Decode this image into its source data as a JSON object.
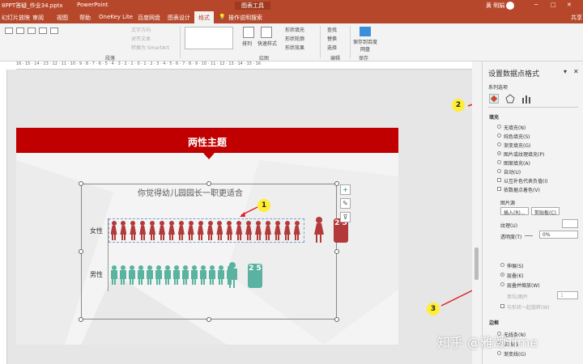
{
  "titlebar": {
    "filename": "8PPT答疑_作业34.pptx",
    "app": "PowerPoint",
    "contextual": "图表工具",
    "user": "黄 明娟"
  },
  "tabs": [
    "幻灯片放映",
    "审阅",
    "视图",
    "帮助",
    "OneKey Lite",
    "百度网盘",
    "图表设计",
    "格式"
  ],
  "active_tab": "格式",
  "tell_me": "操作说明搜索",
  "ribbon": {
    "paragraph": {
      "items": [
        "文字方向",
        "对齐文本",
        "转换为 SmartArt"
      ],
      "label": "段落"
    },
    "drawing": {
      "arrange": "排列",
      "quick_styles": "快速样式",
      "fill": "形状填充",
      "outline": "形状轮廓",
      "effects": "形状效果",
      "label": "绘图"
    },
    "editing": {
      "find": "查找",
      "replace": "替换",
      "select": "选择",
      "label": "编辑"
    },
    "save": {
      "label": "保存到百度网盘",
      "group": "保存"
    }
  },
  "ruler": "16 · 15 · 14 · 13 · 12 · 11 · 10 · 9 · 8 · 7 · 6 · 5 · 4 · 3 · 2 · 1 · 0 · 1 · 2 · 3 · 4 · 5 · 6 · 7 · 8 · 9 · 10 · 11 · 12 · 13 · 14 · 15 · 16",
  "slide": {
    "title": "两性主题",
    "chart_title": "你觉得幼儿园园长一职更适合",
    "female_label": "女性",
    "male_label": "男性",
    "female_value": "2 5",
    "male_value": "2 5",
    "colors": {
      "banner": "#c00000",
      "female": "#b33a3a",
      "male": "#5ab3a0"
    }
  },
  "chart_data": {
    "type": "bar",
    "title": "你觉得幼儿园园长一职更适合",
    "categories": [
      "女性",
      "男性"
    ],
    "values": [
      25,
      25
    ]
  },
  "pane": {
    "title": "设置数据点格式",
    "series_options": "系列选项",
    "fill_section": "填充",
    "fill_options": [
      "无填充(N)",
      "纯色填充(S)",
      "渐变填充(G)",
      "图片或纹理填充(P)",
      "图案填充(A)",
      "自动(U)"
    ],
    "invert": "以互补色代表负值(I)",
    "vary": "依数据点着色(V)",
    "picture_source": "图片源",
    "insert_btn": "插入(R)...",
    "clipboard_btn": "剪贴板(C)",
    "texture": "纹理(U)",
    "transparency": "透明度(T)",
    "transparency_value": "0%",
    "stretch": "伸展(S)",
    "stack": "层叠(K)",
    "stack_scale": "层叠并缩放(W)",
    "units": "单位/图片",
    "units_value": "1",
    "rotate": "与形状一起旋转(W)",
    "border_section": "边框",
    "border_opts": [
      "无线条(N)",
      "实线(S)",
      "渐变线(G)"
    ]
  },
  "callouts": [
    "1",
    "2",
    "3"
  ],
  "watermark": "知乎 @雅颂Time"
}
